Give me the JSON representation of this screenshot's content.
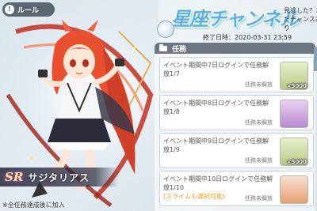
{
  "header": {
    "rule_icon": "!",
    "rule_label": "ルール",
    "title": "星座チャンネル",
    "subtitle": "見逃した？まだチャンスあり",
    "end_date": "終了日時：2020-03-31 23:59"
  },
  "panel": {
    "title": "任務",
    "tasks": [
      {
        "text": "イベント期間中7日ログインで任務解放1/7",
        "highlight": "",
        "status": "任務未解放",
        "reward_type": "coin",
        "reward_icon": "coin-icon",
        "reward_count": "×5000"
      },
      {
        "text": "イベント期間中8日ログインで任務解放1/8",
        "highlight": "",
        "status": "任務未解放",
        "reward_type": "crystal",
        "reward_icon": "crystal-icon",
        "reward_count": ""
      },
      {
        "text": "イベント期間中9日ログインで任務解放1/9",
        "highlight": "",
        "status": "任務未解放",
        "reward_type": "coin",
        "reward_icon": "coin-icon",
        "reward_count": "×5000"
      },
      {
        "text": "イベント期間中10日ログインで任務解放1/10",
        "highlight": "(スライムも選択可能)",
        "status": "任務未解放",
        "reward_type": "portrait",
        "reward_icon": "character-portrait-icon",
        "reward_count": ""
      }
    ]
  },
  "character": {
    "rarity": "SR",
    "name": "サジタリアス"
  },
  "note": "※全任務達成後に加入",
  "colors": {
    "title": "#5ab0e0",
    "panel_header": "#6b7680",
    "highlight": "#e8a020",
    "hair": "#e85030"
  }
}
